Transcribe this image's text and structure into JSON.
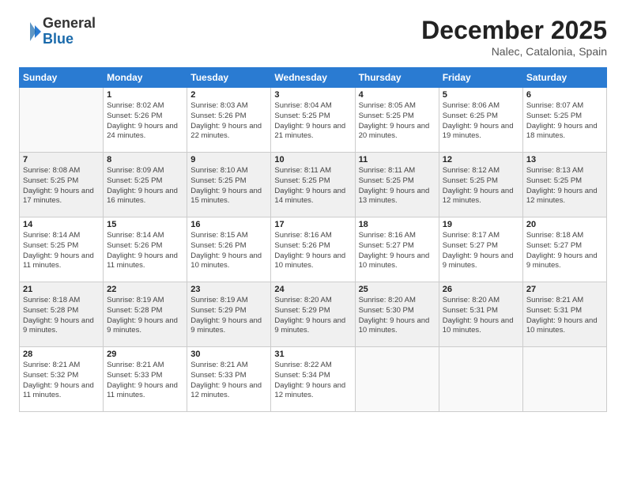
{
  "logo": {
    "general": "General",
    "blue": "Blue"
  },
  "title": "December 2025",
  "location": "Nalec, Catalonia, Spain",
  "days_header": [
    "Sunday",
    "Monday",
    "Tuesday",
    "Wednesday",
    "Thursday",
    "Friday",
    "Saturday"
  ],
  "weeks": [
    [
      {
        "day": "",
        "empty": true
      },
      {
        "day": "1",
        "sunrise": "8:02 AM",
        "sunset": "5:26 PM",
        "daylight": "9 hours and 24 minutes."
      },
      {
        "day": "2",
        "sunrise": "8:03 AM",
        "sunset": "5:26 PM",
        "daylight": "9 hours and 22 minutes."
      },
      {
        "day": "3",
        "sunrise": "8:04 AM",
        "sunset": "5:25 PM",
        "daylight": "9 hours and 21 minutes."
      },
      {
        "day": "4",
        "sunrise": "8:05 AM",
        "sunset": "5:25 PM",
        "daylight": "9 hours and 20 minutes."
      },
      {
        "day": "5",
        "sunrise": "8:06 AM",
        "sunset": "6:25 PM",
        "daylight": "9 hours and 19 minutes."
      },
      {
        "day": "6",
        "sunrise": "8:07 AM",
        "sunset": "5:25 PM",
        "daylight": "9 hours and 18 minutes."
      }
    ],
    [
      {
        "day": "7",
        "sunrise": "8:08 AM",
        "sunset": "5:25 PM",
        "daylight": "9 hours and 17 minutes."
      },
      {
        "day": "8",
        "sunrise": "8:09 AM",
        "sunset": "5:25 PM",
        "daylight": "9 hours and 16 minutes."
      },
      {
        "day": "9",
        "sunrise": "8:10 AM",
        "sunset": "5:25 PM",
        "daylight": "9 hours and 15 minutes."
      },
      {
        "day": "10",
        "sunrise": "8:11 AM",
        "sunset": "5:25 PM",
        "daylight": "9 hours and 14 minutes."
      },
      {
        "day": "11",
        "sunrise": "8:11 AM",
        "sunset": "5:25 PM",
        "daylight": "9 hours and 13 minutes."
      },
      {
        "day": "12",
        "sunrise": "8:12 AM",
        "sunset": "5:25 PM",
        "daylight": "9 hours and 12 minutes."
      },
      {
        "day": "13",
        "sunrise": "8:13 AM",
        "sunset": "5:25 PM",
        "daylight": "9 hours and 12 minutes."
      }
    ],
    [
      {
        "day": "14",
        "sunrise": "8:14 AM",
        "sunset": "5:25 PM",
        "daylight": "9 hours and 11 minutes."
      },
      {
        "day": "15",
        "sunrise": "8:14 AM",
        "sunset": "5:26 PM",
        "daylight": "9 hours and 11 minutes."
      },
      {
        "day": "16",
        "sunrise": "8:15 AM",
        "sunset": "5:26 PM",
        "daylight": "9 hours and 10 minutes."
      },
      {
        "day": "17",
        "sunrise": "8:16 AM",
        "sunset": "5:26 PM",
        "daylight": "9 hours and 10 minutes."
      },
      {
        "day": "18",
        "sunrise": "8:16 AM",
        "sunset": "5:27 PM",
        "daylight": "9 hours and 10 minutes."
      },
      {
        "day": "19",
        "sunrise": "8:17 AM",
        "sunset": "5:27 PM",
        "daylight": "9 hours and 9 minutes."
      },
      {
        "day": "20",
        "sunrise": "8:18 AM",
        "sunset": "5:27 PM",
        "daylight": "9 hours and 9 minutes."
      }
    ],
    [
      {
        "day": "21",
        "sunrise": "8:18 AM",
        "sunset": "5:28 PM",
        "daylight": "9 hours and 9 minutes."
      },
      {
        "day": "22",
        "sunrise": "8:19 AM",
        "sunset": "5:28 PM",
        "daylight": "9 hours and 9 minutes."
      },
      {
        "day": "23",
        "sunrise": "8:19 AM",
        "sunset": "5:29 PM",
        "daylight": "9 hours and 9 minutes."
      },
      {
        "day": "24",
        "sunrise": "8:20 AM",
        "sunset": "5:29 PM",
        "daylight": "9 hours and 9 minutes."
      },
      {
        "day": "25",
        "sunrise": "8:20 AM",
        "sunset": "5:30 PM",
        "daylight": "9 hours and 10 minutes."
      },
      {
        "day": "26",
        "sunrise": "8:20 AM",
        "sunset": "5:31 PM",
        "daylight": "9 hours and 10 minutes."
      },
      {
        "day": "27",
        "sunrise": "8:21 AM",
        "sunset": "5:31 PM",
        "daylight": "9 hours and 10 minutes."
      }
    ],
    [
      {
        "day": "28",
        "sunrise": "8:21 AM",
        "sunset": "5:32 PM",
        "daylight": "9 hours and 11 minutes."
      },
      {
        "day": "29",
        "sunrise": "8:21 AM",
        "sunset": "5:33 PM",
        "daylight": "9 hours and 11 minutes."
      },
      {
        "day": "30",
        "sunrise": "8:21 AM",
        "sunset": "5:33 PM",
        "daylight": "9 hours and 12 minutes."
      },
      {
        "day": "31",
        "sunrise": "8:22 AM",
        "sunset": "5:34 PM",
        "daylight": "9 hours and 12 minutes."
      },
      {
        "day": "",
        "empty": true
      },
      {
        "day": "",
        "empty": true
      },
      {
        "day": "",
        "empty": true
      }
    ]
  ],
  "labels": {
    "sunrise": "Sunrise:",
    "sunset": "Sunset:",
    "daylight": "Daylight:"
  }
}
